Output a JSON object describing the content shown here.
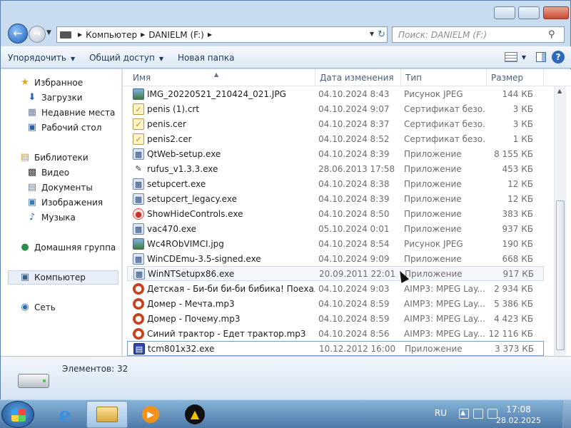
{
  "address": {
    "crumbs": [
      "Компьютер",
      "DANIELM (F:)"
    ]
  },
  "search": {
    "placeholder": "Поиск: DANIELM (F:)"
  },
  "toolbar": {
    "organize": "Упорядочить",
    "share": "Общий доступ",
    "new_folder": "Новая папка"
  },
  "nav": {
    "favorites": "Избранное",
    "downloads": "Загрузки",
    "recent": "Недавние места",
    "desktop": "Рабочий стол",
    "libraries": "Библиотеки",
    "video": "Видео",
    "documents": "Документы",
    "images": "Изображения",
    "music": "Музыка",
    "homegroup": "Домашняя группа",
    "computer": "Компьютер",
    "network": "Сеть"
  },
  "columns": {
    "name": "Имя",
    "date": "Дата изменения",
    "type": "Тип",
    "size": "Размер"
  },
  "files": [
    {
      "name": "IMG_20220521_210424_021.JPG",
      "date": "04.10.2024 8:43",
      "type": "Рисунок JPEG",
      "size": "144 КБ",
      "icon": "image"
    },
    {
      "name": "penis (1).crt",
      "date": "04.10.2024 9:07",
      "type": "Сертификат безо...",
      "size": "3 КБ",
      "icon": "cert"
    },
    {
      "name": "penis.cer",
      "date": "04.10.2024 8:37",
      "type": "Сертификат безо...",
      "size": "3 КБ",
      "icon": "cert"
    },
    {
      "name": "penis2.cer",
      "date": "04.10.2024 8:52",
      "type": "Сертификат безо...",
      "size": "1 КБ",
      "icon": "cert"
    },
    {
      "name": "QtWeb-setup.exe",
      "date": "04.10.2024 8:39",
      "type": "Приложение",
      "size": "8 155 КБ",
      "icon": "app"
    },
    {
      "name": "rufus_v1.3.3.exe",
      "date": "28.06.2013 17:58",
      "type": "Приложение",
      "size": "453 КБ",
      "icon": "usb"
    },
    {
      "name": "setupcert.exe",
      "date": "04.10.2024 8:38",
      "type": "Приложение",
      "size": "12 КБ",
      "icon": "app"
    },
    {
      "name": "setupcert_legacy.exe",
      "date": "04.10.2024 8:39",
      "type": "Приложение",
      "size": "12 КБ",
      "icon": "app"
    },
    {
      "name": "ShowHideControls.exe",
      "date": "04.10.2024 8:50",
      "type": "Приложение",
      "size": "383 КБ",
      "icon": "red"
    },
    {
      "name": "vac470.exe",
      "date": "05.10.2024 0:01",
      "type": "Приложение",
      "size": "937 КБ",
      "icon": "app"
    },
    {
      "name": "Wc4RObVIMCI.jpg",
      "date": "04.10.2024 8:54",
      "type": "Рисунок JPEG",
      "size": "190 КБ",
      "icon": "image"
    },
    {
      "name": "WinCDEmu-3.5-signed.exe",
      "date": "04.10.2024 9:09",
      "type": "Приложение",
      "size": "668 КБ",
      "icon": "app"
    },
    {
      "name": "WinNTSetupx86.exe",
      "date": "20.09.2011 22:01",
      "type": "Приложение",
      "size": "917 КБ",
      "icon": "app"
    },
    {
      "name": "Детская - Би-би би-би бибика! Поехал...",
      "date": "04.10.2024 9:03",
      "type": "AIMP3: MPEG Lay...",
      "size": "2 934 КБ",
      "icon": "mp3"
    },
    {
      "name": "Домер - Мечта.mp3",
      "date": "04.10.2024 8:59",
      "type": "AIMP3: MPEG Lay...",
      "size": "5 386 КБ",
      "icon": "mp3"
    },
    {
      "name": "Домер - Почему.mp3",
      "date": "04.10.2024 8:59",
      "type": "AIMP3: MPEG Lay...",
      "size": "4 423 КБ",
      "icon": "mp3"
    },
    {
      "name": "Синий трактор - Едет трактор.mp3",
      "date": "04.10.2024 8:56",
      "type": "AIMP3: MPEG Lay...",
      "size": "12 116 КБ",
      "icon": "mp3"
    },
    {
      "name": "tcm801x32.exe",
      "date": "10.12.2012 16:00",
      "type": "Приложение",
      "size": "3 373 КБ",
      "icon": "disk"
    }
  ],
  "status": {
    "items_count": "Элементов: 32"
  },
  "taskbar": {
    "lang": "RU",
    "time": "17:08",
    "date": "28.02.2025"
  }
}
